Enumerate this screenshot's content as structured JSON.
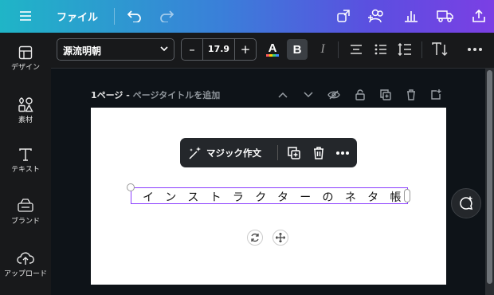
{
  "topbar": {
    "menu_icon": "hamburger-icon",
    "file_label": "ファイル",
    "icons": [
      "undo-icon",
      "redo-icon",
      "magic-resize-icon",
      "share-people-icon",
      "analytics-icon",
      "delivery-truck-icon",
      "upload-share-icon"
    ]
  },
  "sidebar": {
    "items": [
      {
        "label": "デザイン",
        "icon": "design-icon"
      },
      {
        "label": "素材",
        "icon": "elements-icon"
      },
      {
        "label": "テキスト",
        "icon": "text-icon"
      },
      {
        "label": "ブランド",
        "icon": "brand-icon"
      },
      {
        "label": "アップロード",
        "icon": "upload-icon"
      }
    ]
  },
  "toolbar": {
    "font_name": "源流明朝",
    "font_size": "17.9",
    "minus": "–",
    "plus": "+",
    "bold": "B",
    "italic": "I",
    "text_color": "#000000"
  },
  "page": {
    "title_prefix": "1ページ - ",
    "title_placeholder": "ページタイトルを追加"
  },
  "float_bar": {
    "magic_label": "マジック作文"
  },
  "canvas_text": "インストラクターのネタ帳",
  "colors": {
    "accent": "#8b3dff",
    "toolbar_bg": "#18191b",
    "canvas_bg": "#0e1318"
  }
}
